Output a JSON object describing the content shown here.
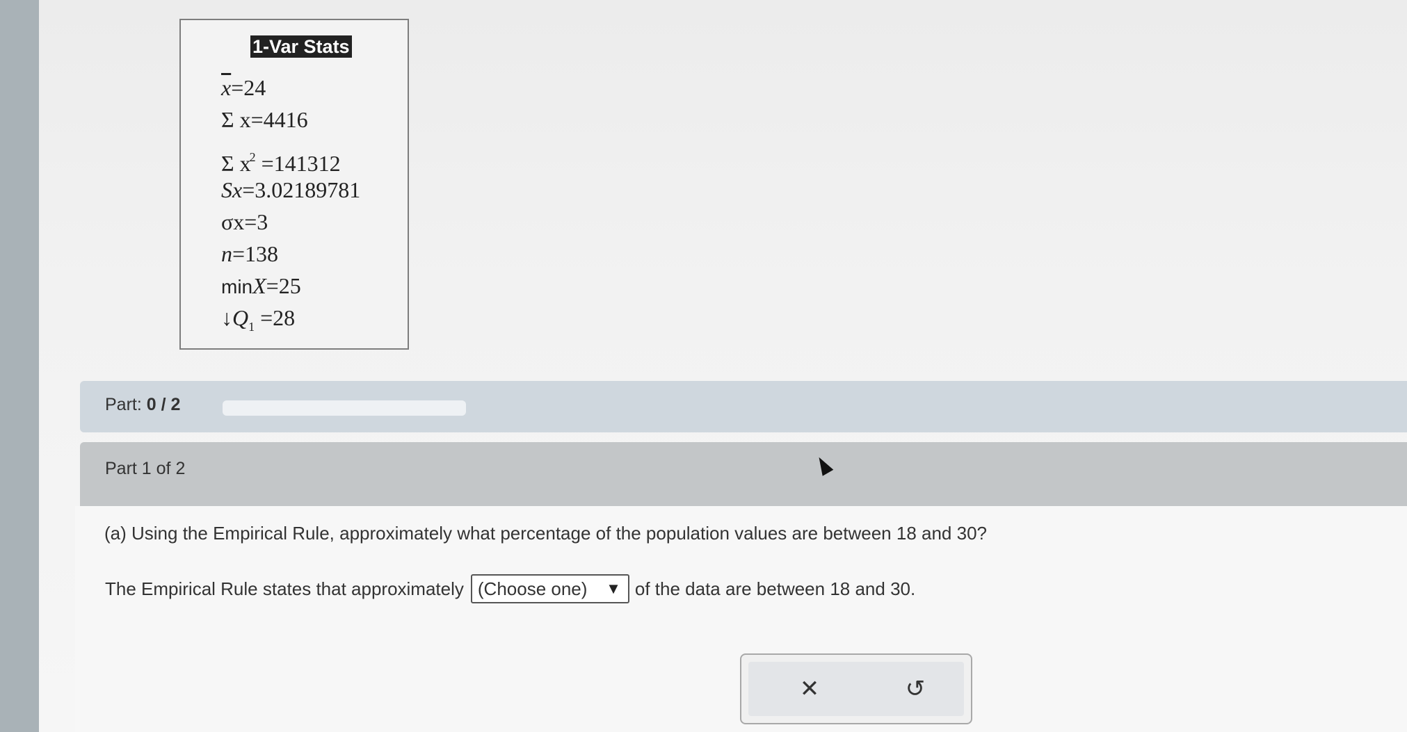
{
  "stats": {
    "title": "1-Var Stats",
    "mean_label": "x",
    "mean_value": "=24",
    "sum_x_label": "Σ x",
    "sum_x_value": "=4416",
    "sum_x2_label": "Σ x",
    "sum_x2_exp": "2",
    "sum_x2_value": " =141312",
    "sx_label": "Sx",
    "sx_value": "=3.02189781",
    "sigma_label": "σx",
    "sigma_value": "=3",
    "n_label": "n",
    "n_value": "=138",
    "min_prefix": "min",
    "min_label": "X",
    "min_value": "=25",
    "q1_arrow": "↓",
    "q1_label": "Q",
    "q1_sub": "1",
    "q1_value": " =28"
  },
  "part": {
    "label": "Part: ",
    "progress_text": "0 / 2",
    "progress_fraction": 0
  },
  "section": {
    "header": "Part 1 of 2",
    "question": "(a) Using the Empirical Rule, approximately what percentage of the population values are between 18 and 30?",
    "answer_prefix": "The Empirical Rule states that approximately",
    "select_value": "(Choose one)",
    "answer_suffix": "of the data are between 18 and 30."
  },
  "buttons": {
    "clear_icon": "close-icon",
    "clear_glyph": "✕",
    "undo_icon": "undo-icon",
    "undo_glyph": "↺"
  }
}
